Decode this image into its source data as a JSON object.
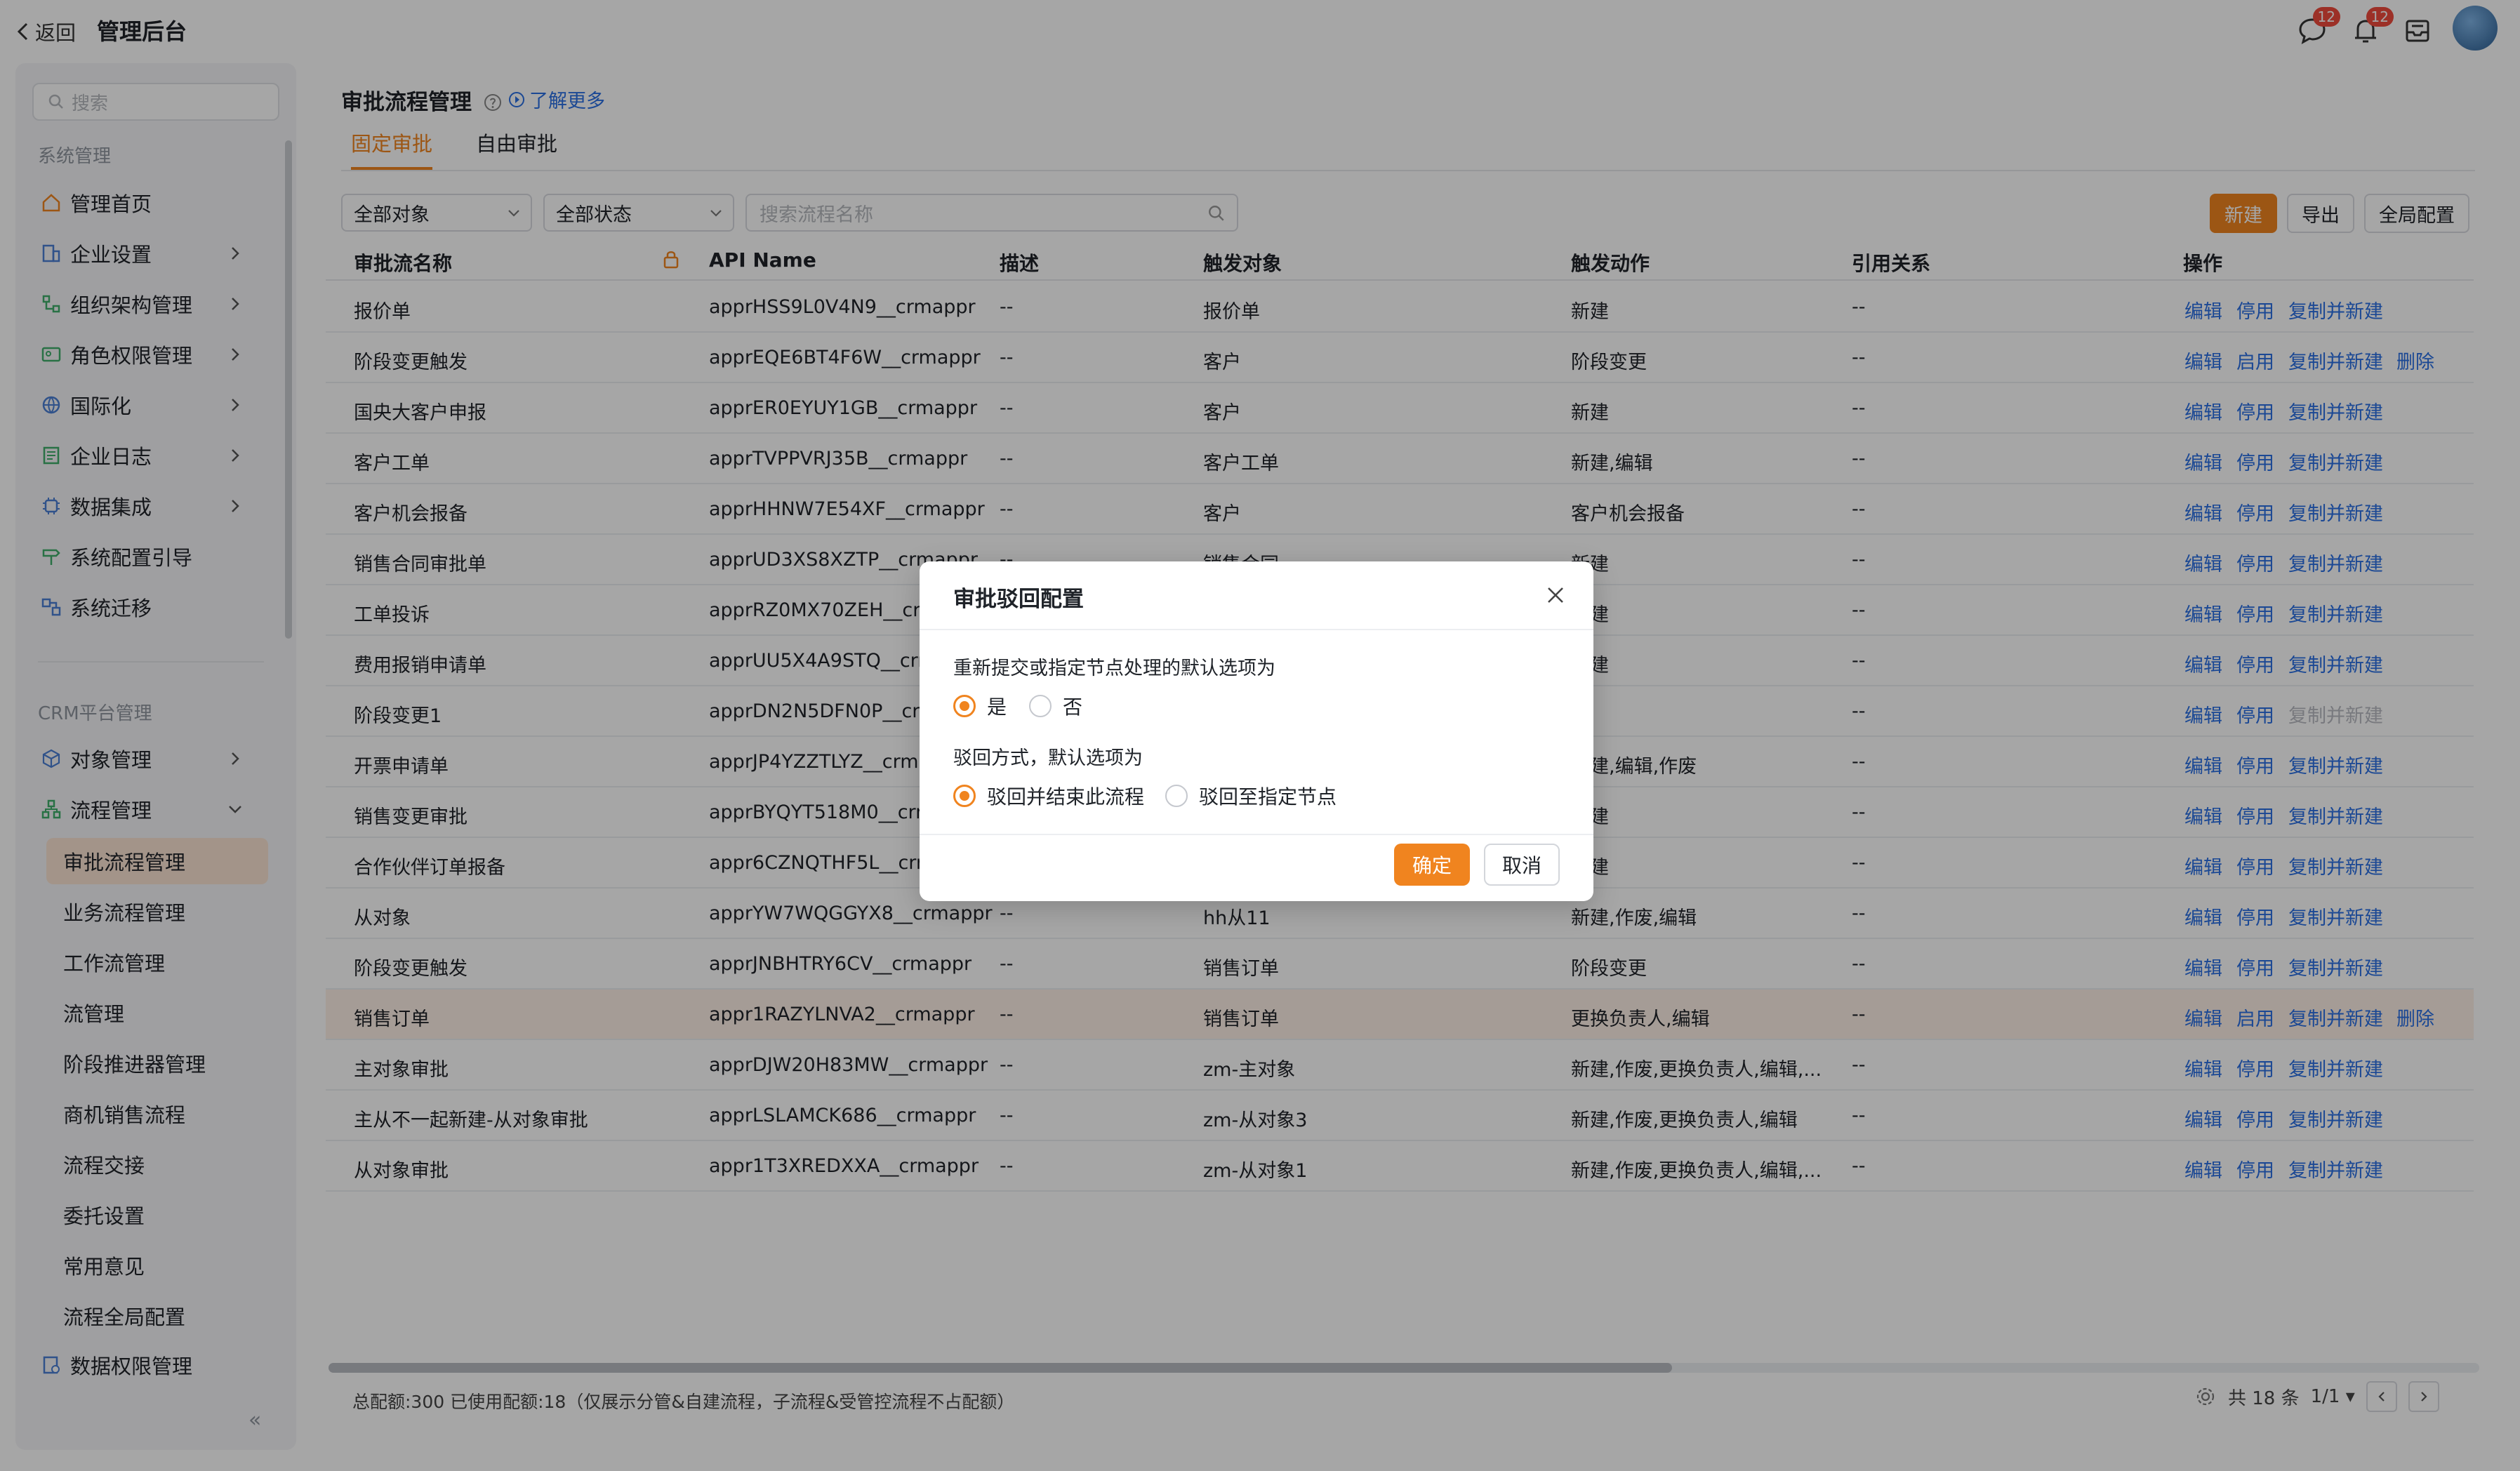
{
  "topbar": {
    "back_label": "返回",
    "app_title": "管理后台",
    "chat_badge": "12",
    "notify_badge": "12"
  },
  "sidebar": {
    "search_placeholder": "搜索",
    "group1": "系统管理",
    "items1": [
      "管理首页",
      "企业设置",
      "组织架构管理",
      "角色权限管理",
      "国际化",
      "企业日志",
      "数据集成",
      "系统配置引导",
      "系统迁移"
    ],
    "group2": "CRM平台管理",
    "items2": [
      "对象管理",
      "流程管理"
    ],
    "subitems": [
      "审批流程管理",
      "业务流程管理",
      "工作流管理",
      "流管理",
      "阶段推进器管理",
      "商机销售流程",
      "流程交接",
      "委托设置",
      "常用意见",
      "流程全局配置"
    ],
    "last_item": "数据权限管理",
    "active_sub": "审批流程管理"
  },
  "page": {
    "title": "审批流程管理",
    "learn_more": "了解更多",
    "tabs": [
      "固定审批",
      "自由审批"
    ],
    "filter_object": "全部对象",
    "filter_status": "全部状态",
    "search_placeholder": "搜索流程名称",
    "btn_new": "新建",
    "btn_export": "导出",
    "btn_global": "全局配置"
  },
  "table": {
    "headers": [
      "审批流名称",
      "API Name",
      "描述",
      "触发对象",
      "触发动作",
      "引用关系",
      "操作"
    ],
    "rows": [
      {
        "name": "报价单",
        "api": "apprHSS9L0V4N9__crmappr",
        "desc": "--",
        "obj": "报价单",
        "action": "新建",
        "ref": "--",
        "ops": [
          "编辑",
          "停用",
          "复制并新建"
        ]
      },
      {
        "name": "阶段变更触发",
        "api": "apprEQE6BT4F6W__crmappr",
        "desc": "--",
        "obj": "客户",
        "action": "阶段变更",
        "ref": "--",
        "ops": [
          "编辑",
          "启用",
          "复制并新建",
          "删除"
        ]
      },
      {
        "name": "国央大客户申报",
        "api": "apprER0EYUY1GB__crmappr",
        "desc": "--",
        "obj": "客户",
        "action": "新建",
        "ref": "--",
        "ops": [
          "编辑",
          "停用",
          "复制并新建"
        ]
      },
      {
        "name": "客户工单",
        "api": "apprTVPPVRJ35B__crmappr",
        "desc": "--",
        "obj": "客户工单",
        "action": "新建,编辑",
        "ref": "--",
        "ops": [
          "编辑",
          "停用",
          "复制并新建"
        ]
      },
      {
        "name": "客户机会报备",
        "api": "apprHHNW7E54XF__crmappr",
        "desc": "--",
        "obj": "客户",
        "action": "客户机会报备",
        "ref": "--",
        "ops": [
          "编辑",
          "停用",
          "复制并新建"
        ]
      },
      {
        "name": "销售合同审批单",
        "api": "apprUD3XS8XZTP__crmappr",
        "desc": "--",
        "obj": "销售合同",
        "action": "新建",
        "ref": "--",
        "ops": [
          "编辑",
          "停用",
          "复制并新建"
        ]
      },
      {
        "name": "工单投诉",
        "api": "apprRZ0MX70ZEH__crmappr",
        "desc": "--",
        "obj": "",
        "action": "新建",
        "ref": "--",
        "ops": [
          "编辑",
          "停用",
          "复制并新建"
        ]
      },
      {
        "name": "费用报销申请单",
        "api": "apprUU5X4A9STQ__crmappr",
        "desc": "--",
        "obj": "",
        "action": "新建",
        "ref": "--",
        "ops": [
          "编辑",
          "停用",
          "复制并新建"
        ]
      },
      {
        "name": "阶段变更1",
        "api": "apprDN2N5DFN0P__crmappr",
        "desc": "--",
        "obj": "",
        "action": "",
        "ref": "--",
        "ops": [
          "编辑",
          "停用",
          "复制并新建"
        ]
      },
      {
        "name": "开票申请单",
        "api": "apprJP4YZZTLYZ__crmappr",
        "desc": "--",
        "obj": "",
        "action": "新建,编辑,作废",
        "ref": "--",
        "ops": [
          "编辑",
          "停用",
          "复制并新建"
        ]
      },
      {
        "name": "销售变更审批",
        "api": "apprBYQYT518M0__crmappr",
        "desc": "--",
        "obj": "",
        "action": "新建",
        "ref": "--",
        "ops": [
          "编辑",
          "停用",
          "复制并新建"
        ]
      },
      {
        "name": "合作伙伴订单报备",
        "api": "appr6CZNQTHF5L__crmappr",
        "desc": "--",
        "obj": "",
        "action": "新建",
        "ref": "--",
        "ops": [
          "编辑",
          "停用",
          "复制并新建"
        ]
      },
      {
        "name": "从对象",
        "api": "apprYW7WQGGYX8__crmappr",
        "desc": "--",
        "obj": "hh从11",
        "action": "新建,作废,编辑",
        "ref": "--",
        "ops": [
          "编辑",
          "停用",
          "复制并新建"
        ]
      },
      {
        "name": "阶段变更触发",
        "api": "apprJNBHTRY6CV__crmappr",
        "desc": "--",
        "obj": "销售订单",
        "action": "阶段变更",
        "ref": "--",
        "ops": [
          "编辑",
          "停用",
          "复制并新建"
        ]
      },
      {
        "name": "销售订单",
        "api": "appr1RAZYLNVA2__crmappr",
        "desc": "--",
        "obj": "销售订单",
        "action": "更换负责人,编辑",
        "ref": "--",
        "ops": [
          "编辑",
          "启用",
          "复制并新建",
          "删除"
        ]
      },
      {
        "name": "主对象审批",
        "api": "apprDJW20H83MW__crmappr",
        "desc": "--",
        "obj": "zm-主对象",
        "action": "新建,作废,更换负责人,编辑,...",
        "ref": "--",
        "ops": [
          "编辑",
          "停用",
          "复制并新建"
        ]
      },
      {
        "name": "主从不一起新建-从对象审批",
        "api": "apprLSLAMCK686__crmappr",
        "desc": "--",
        "obj": "zm-从对象3",
        "action": "新建,作废,更换负责人,编辑",
        "ref": "--",
        "ops": [
          "编辑",
          "停用",
          "复制并新建"
        ]
      },
      {
        "name": "从对象审批",
        "api": "appr1T3XREDXXA__crmappr",
        "desc": "--",
        "obj": "zm-从对象1",
        "action": "新建,作废,更换负责人,编辑,...",
        "ref": "--",
        "ops": [
          "编辑",
          "停用",
          "复制并新建"
        ]
      }
    ],
    "highlight_row": 14,
    "disabled_op_row": 8
  },
  "footer": {
    "quota": "总配额:300 已使用配额:18（仅展示分管&自建流程，子流程&受管控流程不占配额）",
    "total": "共 18 条",
    "page": "1/1"
  },
  "modal": {
    "title": "审批驳回配置",
    "q1": "重新提交或指定节点处理的默认选项为",
    "q1_opts": [
      "是",
      "否"
    ],
    "q2": "驳回方式，默认选项为",
    "q2_opts": [
      "驳回并结束此流程",
      "驳回至指定节点"
    ],
    "ok": "确定",
    "cancel": "取消"
  },
  "colors": {
    "accent": "#f0841f",
    "link": "#2a6fe3"
  }
}
